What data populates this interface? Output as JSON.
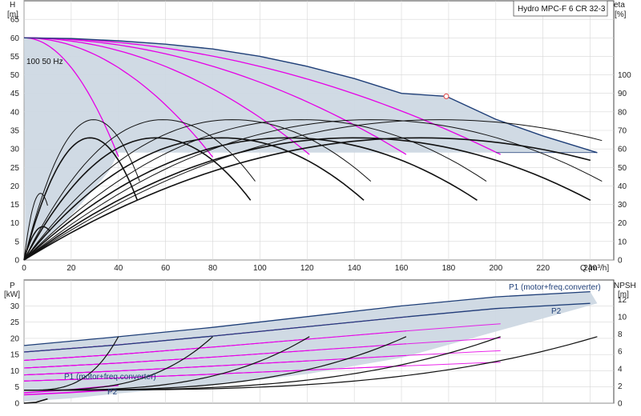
{
  "chart_data": [
    {
      "type": "line",
      "title": "Hydro MPC-F 6 CR 32-3",
      "xlabel": "Q [m³/h]",
      "ylabel": "H [m]",
      "ylabel_right": "eta [%]",
      "xlim": [
        0,
        250
      ],
      "ylim": [
        0,
        70
      ],
      "xticks": [
        "0",
        "20",
        "40",
        "60",
        "80",
        "100",
        "120",
        "140",
        "160",
        "180",
        "200",
        "220",
        "240"
      ],
      "yticks": [
        "0",
        "5",
        "10",
        "15",
        "20",
        "25",
        "30",
        "35",
        "40",
        "45",
        "50",
        "55",
        "60",
        "65"
      ],
      "yticks_right": [
        "0",
        "10",
        "20",
        "30",
        "40",
        "50",
        "60",
        "70",
        "80",
        "90",
        "100"
      ],
      "x_unit_label": "Q [m³/h]",
      "y_name": "H",
      "y_unit": "[m]",
      "y2_name": "eta",
      "y2_unit": "[%]",
      "grid": true,
      "annotation": "100 50 Hz",
      "operating_point": {
        "x": 179,
        "y": 44.2
      },
      "envelope_color": "#cdd8e3",
      "full_speed_color": "#1f3f78",
      "reduced_speed_color": "#e600e6",
      "efficiency_color": "#111111",
      "max_curve": [
        [
          0,
          60
        ],
        [
          20,
          59.8
        ],
        [
          40,
          59.2
        ],
        [
          60,
          58.3
        ],
        [
          80,
          57
        ],
        [
          100,
          55
        ],
        [
          120,
          52.3
        ],
        [
          140,
          49
        ],
        [
          160,
          45
        ],
        [
          179,
          44.2
        ],
        [
          200,
          38
        ],
        [
          220,
          33.5
        ],
        [
          243,
          29
        ]
      ],
      "min_curve_y": 29,
      "pumps": [
        {
          "qmax": 40,
          "h_end": 27.9
        },
        {
          "qmax": 80,
          "h_end": 27.8
        },
        {
          "qmax": 121,
          "h_end": 28.5
        },
        {
          "qmax": 162,
          "h_end": 28.5
        },
        {
          "qmax": 202,
          "h_end": 28.5
        }
      ],
      "efficiency_peaks": [
        {
          "n": 1,
          "q_opt": 28,
          "eta_peak": 72
        },
        {
          "n": 2,
          "q_opt": 56,
          "eta_peak": 72
        },
        {
          "n": 3,
          "q_opt": 84,
          "eta_peak": 72
        },
        {
          "n": 4,
          "q_opt": 112,
          "eta_peak": 72
        },
        {
          "n": 5,
          "q_opt": 140,
          "eta_peak": 72
        },
        {
          "n": 6,
          "q_opt": 168,
          "eta_peak": 72
        }
      ]
    },
    {
      "type": "line",
      "xlabel": "",
      "ylabel": "P [kW]",
      "ylabel_right": "NPSH [m]",
      "xlim": [
        0,
        250
      ],
      "ylim": [
        0,
        38
      ],
      "yticks": [
        "0",
        "5",
        "10",
        "15",
        "20",
        "25",
        "30"
      ],
      "yticks_right": [
        "0",
        "2",
        "4",
        "6",
        "8",
        "10",
        "12"
      ],
      "y_name": "P",
      "y_unit": "[kW]",
      "y2_name": "NPSH",
      "y2_unit": "[m]",
      "grid": true,
      "labels": {
        "p1_top": "P1 (motor+freq.converter)",
        "p2_top": "P2",
        "p1_low": "P1 (motor+freq.converter)",
        "p2_low": "P2"
      },
      "p1_max": [
        [
          0,
          17.8
        ],
        [
          40,
          20.5
        ],
        [
          80,
          23.4
        ],
        [
          120,
          26.7
        ],
        [
          160,
          30
        ],
        [
          200,
          32.8
        ],
        [
          240,
          34.4
        ]
      ],
      "p2_max": [
        [
          0,
          15.8
        ],
        [
          40,
          18
        ],
        [
          80,
          20.7
        ],
        [
          120,
          23.6
        ],
        [
          160,
          26.5
        ],
        [
          200,
          29.2
        ],
        [
          240,
          30.8
        ]
      ],
      "npsh_curves": [
        {
          "qmax": 40,
          "npsh_end": 7.7
        },
        {
          "qmax": 80,
          "npsh_end": 7.7
        },
        {
          "qmax": 121,
          "npsh_end": 7.7
        },
        {
          "qmax": 162,
          "npsh_end": 7.7
        },
        {
          "qmax": 202,
          "npsh_end": 7.7
        },
        {
          "qmax": 243,
          "npsh_end": 7.7
        }
      ]
    }
  ]
}
